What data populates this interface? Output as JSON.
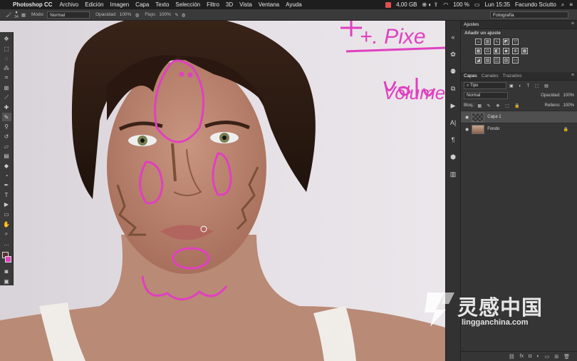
{
  "menubar": {
    "app_name": "Photoshop CC",
    "items": [
      "Archivo",
      "Edición",
      "Imagen",
      "Capa",
      "Texto",
      "Selección",
      "Filtro",
      "3D",
      "Vista",
      "Ventana",
      "Ayuda"
    ],
    "memory": "4,00 GB",
    "battery": "100 %",
    "clock": "Lun 15:35",
    "user": "Facundo Sciutto"
  },
  "options": {
    "brush_size": "34",
    "mode_label": "Modo:",
    "mode_value": "Normal",
    "opacity_label": "Opacidad:",
    "opacity_value": "100%",
    "flow_label": "Flujo:",
    "flow_value": "100%",
    "workspace": "Fotografía"
  },
  "canvas": {
    "annotation_top": "+. Pixe",
    "annotation_right": "Volume"
  },
  "adjustments": {
    "tab": "Ajustes",
    "subtitle": "Añadir un ajuste"
  },
  "layers": {
    "tabs": [
      "Capas",
      "Canales",
      "Trazados"
    ],
    "filter": "Tipo",
    "blend": "Normal",
    "opacity_label": "Opacidad:",
    "opacity_value": "100%",
    "lock_label": "Bloq.:",
    "fill_label": "Relleno:",
    "fill_value": "100%",
    "items": [
      {
        "name": "Capa 1",
        "selected": true
      },
      {
        "name": "Fondo",
        "selected": false
      }
    ]
  },
  "watermark": {
    "cn": "灵感中国",
    "url": "lingganchina.com"
  },
  "colors": {
    "accent_pink": "#e040c0",
    "foreground": "#5a3030"
  }
}
